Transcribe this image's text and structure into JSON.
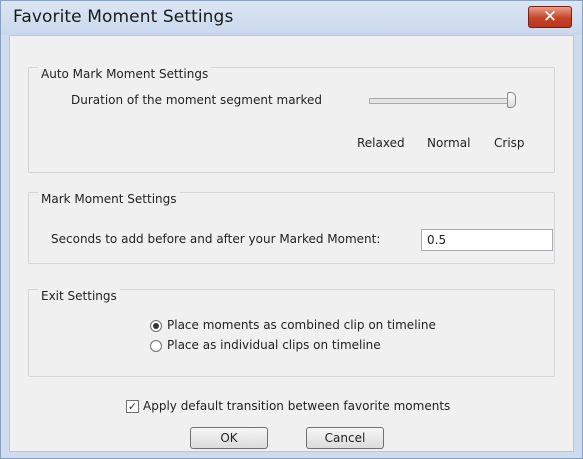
{
  "window": {
    "title": "Favorite Moment Settings",
    "close_glyph": "✕"
  },
  "auto_mark": {
    "group_title": "Auto Mark Moment Settings",
    "duration_label": "Duration of the moment segment marked",
    "slider_value": "Crisp",
    "scale_labels": [
      "Relaxed",
      "Normal",
      "Crisp"
    ]
  },
  "mark_moment": {
    "group_title": "Mark Moment Settings",
    "seconds_label": "Seconds to add before and after your Marked Moment:",
    "seconds_value": "0.5"
  },
  "exit": {
    "group_title": "Exit Settings",
    "options": [
      {
        "label": "Place moments as combined clip on timeline",
        "selected": true
      },
      {
        "label": "Place as individual clips on timeline",
        "selected": false
      }
    ]
  },
  "apply_transition": {
    "label": "Apply default transition between favorite moments",
    "checked": true,
    "check_glyph": "✓"
  },
  "buttons": {
    "ok": "OK",
    "cancel": "Cancel"
  }
}
